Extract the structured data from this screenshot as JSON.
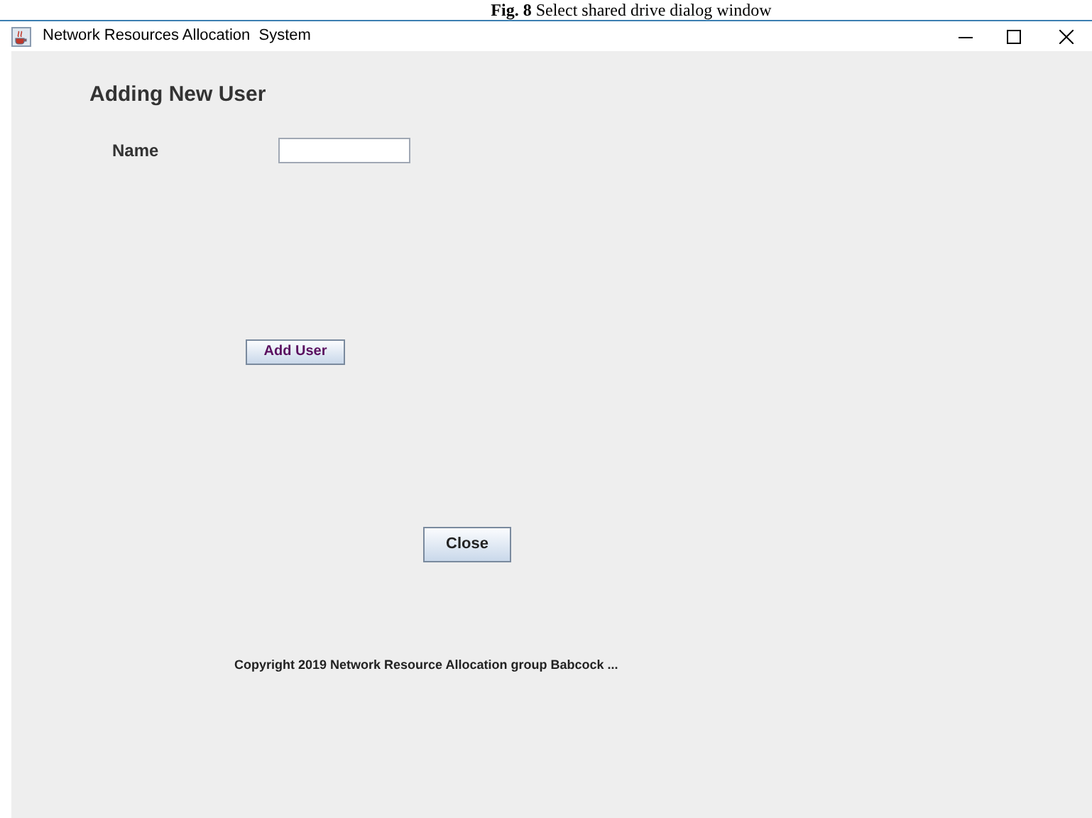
{
  "caption": {
    "label": "Fig. 8",
    "text": "Select shared drive dialog window"
  },
  "window": {
    "title": "Network Resources Allocation  System"
  },
  "form": {
    "heading": "Adding New User",
    "name_label": "Name",
    "add_button": "Add User",
    "close_button": "Close",
    "footer": "Copyright 2019 Network Resource Allocation group Babcock ..."
  }
}
